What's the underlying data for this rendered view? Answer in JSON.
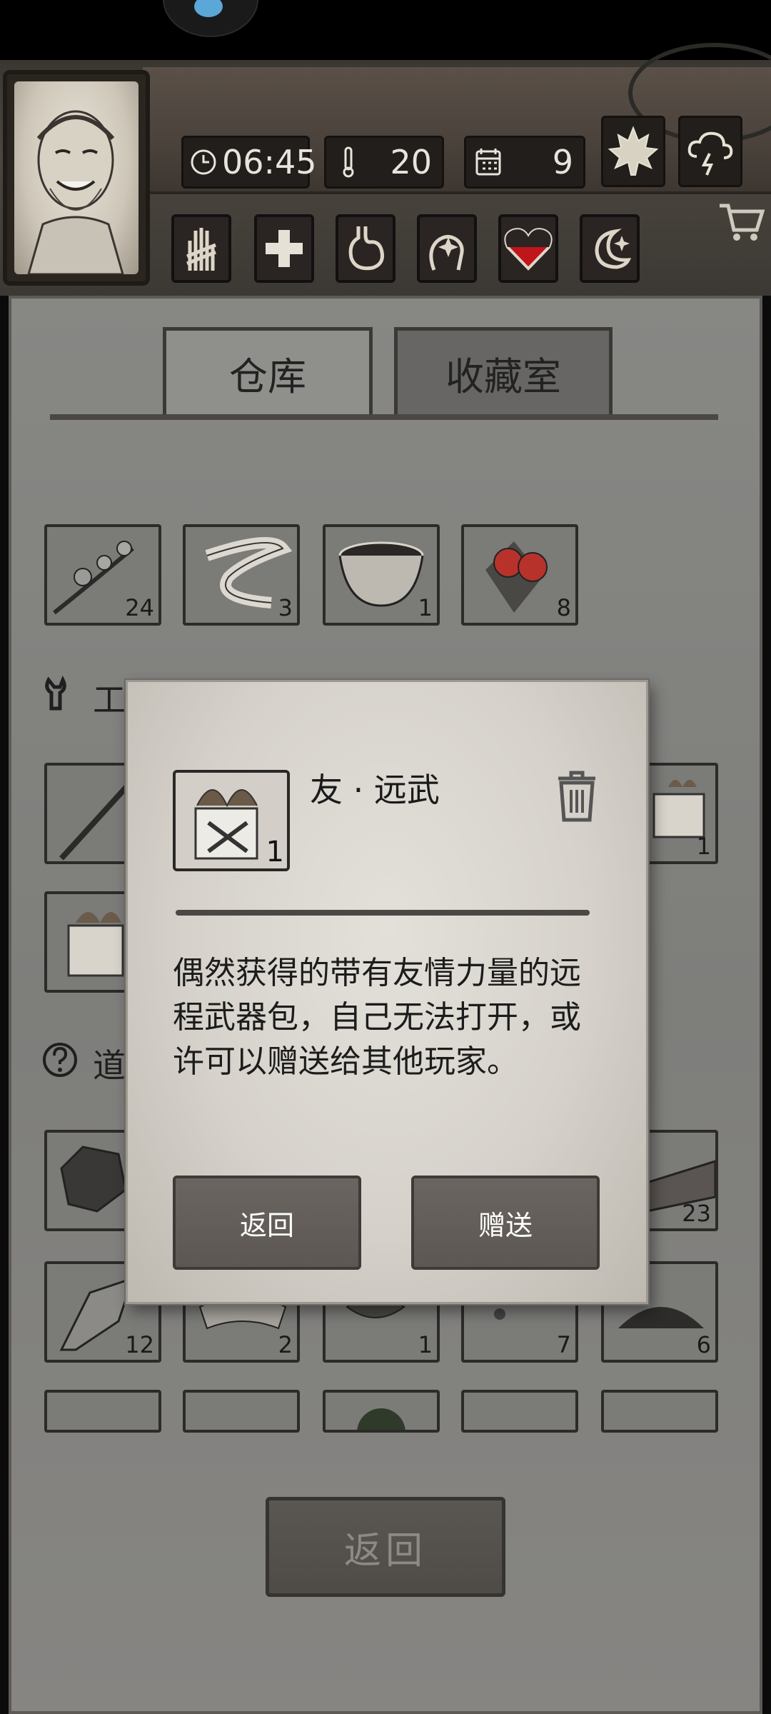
{
  "header": {
    "time": "06:45",
    "temperature": "20",
    "day": "9",
    "season_icon": "maple-leaf-icon",
    "weather_icon": "storm-cloud-icon",
    "status_icons": [
      "hand-bandage-icon",
      "health-cross-icon",
      "stomach-icon",
      "mind-icon",
      "heart-icon",
      "moon-sleep-icon"
    ],
    "cart_icon": "shopping-cart-icon"
  },
  "tabs": [
    {
      "label": "仓库",
      "active": false
    },
    {
      "label": "收藏室",
      "active": true
    }
  ],
  "inventory": {
    "row1": [
      {
        "icon": "herb-branch-icon",
        "qty": "24"
      },
      {
        "icon": "cloth-bandage-icon",
        "qty": "3"
      },
      {
        "icon": "bowl-icon",
        "qty": "1"
      },
      {
        "icon": "berries-icon",
        "qty": "8"
      }
    ],
    "tools_section": {
      "label": "工",
      "icon": "wrench-icon"
    },
    "tools_row1_left": {
      "icon": "pickaxe-icon"
    },
    "tools_row1_right": {
      "icon": "gift-box-icon",
      "qty": "1"
    },
    "tools_row2_left": {
      "icon": "gift-box-icon"
    },
    "props_section": {
      "label": "道",
      "icon": "question-icon"
    },
    "props_row1_left": {
      "icon": "stone-icon"
    },
    "props_row1_right": {
      "icon": "plank-icon",
      "qty": "23"
    },
    "row5": [
      {
        "icon": "flint-icon",
        "qty": "12"
      },
      {
        "icon": "tiger-pelt-icon",
        "qty": "2"
      },
      {
        "icon": "leaves-icon",
        "qty": "1"
      },
      {
        "icon": "seeds-icon",
        "qty": "7"
      },
      {
        "icon": "soil-icon",
        "qty": "6"
      }
    ]
  },
  "main_return_label": "返回",
  "dialog": {
    "item_name": "友 · 远武",
    "item_qty": "1",
    "item_icon": "gift-box-weapon-icon",
    "description": "偶然获得的带有友情力量的远程武器包，自己无法打开，或许可以赠送给其他玩家。",
    "back_label": "返回",
    "gift_label": "赠送",
    "trash_icon": "trash-icon"
  },
  "colors": {
    "panel": "#7e7e7b",
    "dialog": "#d6d2cb",
    "button": "#5c5753",
    "heart": "#c0151b"
  }
}
